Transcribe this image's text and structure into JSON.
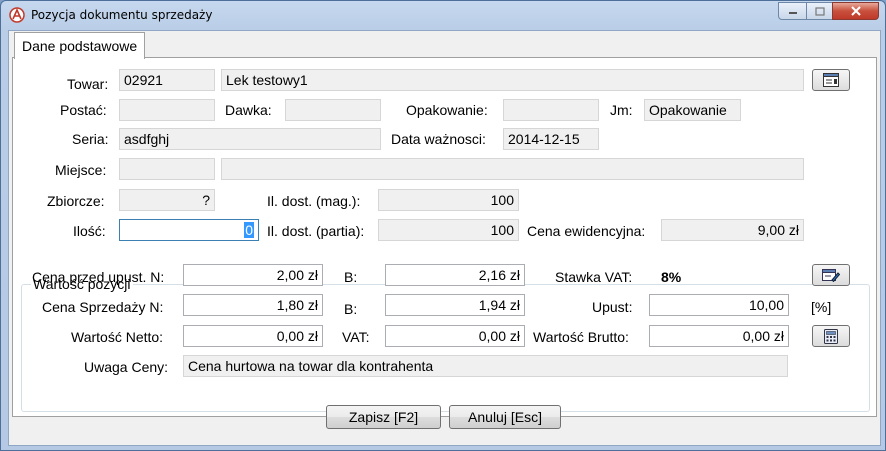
{
  "window": {
    "title": "Pozycja dokumentu sprzedaży"
  },
  "tab": {
    "label": "Dane podstawowe"
  },
  "product": {
    "towar_label": "Towar:",
    "towar_code": "02921",
    "towar_name": "Lek testowy1",
    "postac_label": "Postać:",
    "postac_value": "",
    "dawka_label": "Dawka:",
    "dawka_value": "",
    "opakowanie_label": "Opakowanie:",
    "opakowanie_value": "",
    "jm_label": "Jm:",
    "jm_value": "Opakowanie",
    "seria_label": "Seria:",
    "seria_value": "asdfghj",
    "data_waznosci_label": "Data ważnosci:",
    "data_waznosci_value": "2014-12-15",
    "miejsce_label": "Miejsce:",
    "miejsce_code": "",
    "miejsce_name": "",
    "zbiorcze_label": "Zbiorcze:",
    "zbiorcze_value": "?",
    "il_dost_mag_label": "Il. dost. (mag.):",
    "il_dost_mag_value": "100",
    "ilosc_label": "Ilość:",
    "ilosc_value": "0",
    "il_dost_partia_label": "Il. dost. (partia):",
    "il_dost_partia_value": "100",
    "cena_ewid_label": "Cena ewidencyjna:",
    "cena_ewid_value": "9,00 zł"
  },
  "wartosc": {
    "group_title": "Wartość pozycji",
    "cena_przed_label": "Cena przed upust. N:",
    "cena_przed_value": "2,00 zł",
    "b1_label": "B:",
    "b1_value": "2,16 zł",
    "stawka_vat_label": "Stawka VAT:",
    "stawka_vat_value": "8%",
    "cena_sprzedazy_label": "Cena Sprzedaży N:",
    "cena_sprzedazy_value": "1,80 zł",
    "b2_label": "B:",
    "b2_value": "1,94 zł",
    "upust_label": "Upust:",
    "upust_value": "10,00",
    "upust_unit": "[%]",
    "wartosc_netto_label": "Wartość Netto:",
    "wartosc_netto_value": "0,00 zł",
    "vat_label": "VAT:",
    "vat_value": "0,00 zł",
    "wartosc_brutto_label": "Wartość Brutto:",
    "wartosc_brutto_value": "0,00 zł",
    "uwaga_label": "Uwaga Ceny:",
    "uwaga_value": "Cena hurtowa na towar dla kontrahenta"
  },
  "buttons": {
    "save": "Zapisz [F2]",
    "cancel": "Anuluj [Esc]"
  },
  "icons": {
    "app": "app-logo-icon",
    "product_picker": "list-picker-icon",
    "price_edit": "edit-form-icon",
    "calculator": "calculator-icon"
  }
}
